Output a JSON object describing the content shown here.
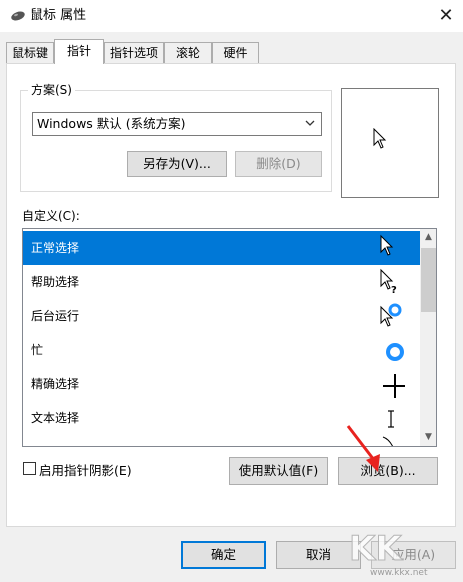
{
  "window": {
    "title": "鼠标 属性",
    "close_glyph": "✕"
  },
  "tabs": [
    {
      "label": "鼠标键",
      "active": false
    },
    {
      "label": "指针",
      "active": true
    },
    {
      "label": "指针选项",
      "active": false
    },
    {
      "label": "滚轮",
      "active": false
    },
    {
      "label": "硬件",
      "active": false
    }
  ],
  "scheme": {
    "legend": "方案(S)",
    "selected": "Windows 默认 (系统方案)",
    "save_as_label": "另存为(V)...",
    "delete_label": "删除(D)"
  },
  "custom_label": "自定义(C):",
  "cursor_list": {
    "items": [
      {
        "label": "正常选择",
        "icon": "arrow-cursor-icon",
        "selected": true
      },
      {
        "label": "帮助选择",
        "icon": "help-cursor-icon",
        "selected": false
      },
      {
        "label": "后台运行",
        "icon": "working-in-background-cursor-icon",
        "selected": false
      },
      {
        "label": "忙",
        "icon": "busy-cursor-icon",
        "selected": false
      },
      {
        "label": "精确选择",
        "icon": "crosshair-cursor-icon",
        "selected": false
      },
      {
        "label": "文本选择",
        "icon": "text-select-cursor-icon",
        "selected": false
      }
    ]
  },
  "shadow": {
    "label": "启用指针阴影(E)",
    "checked": false
  },
  "buttons": {
    "use_default": "使用默认值(F)",
    "browse": "浏览(B)...",
    "ok": "确定",
    "cancel": "取消",
    "apply": "应用(A)"
  },
  "watermark": {
    "text": "www.kkx.net"
  },
  "colors": {
    "selection": "#0078d7",
    "busy_ring": "#1e90ff",
    "annotation_arrow": "#e8231f"
  }
}
